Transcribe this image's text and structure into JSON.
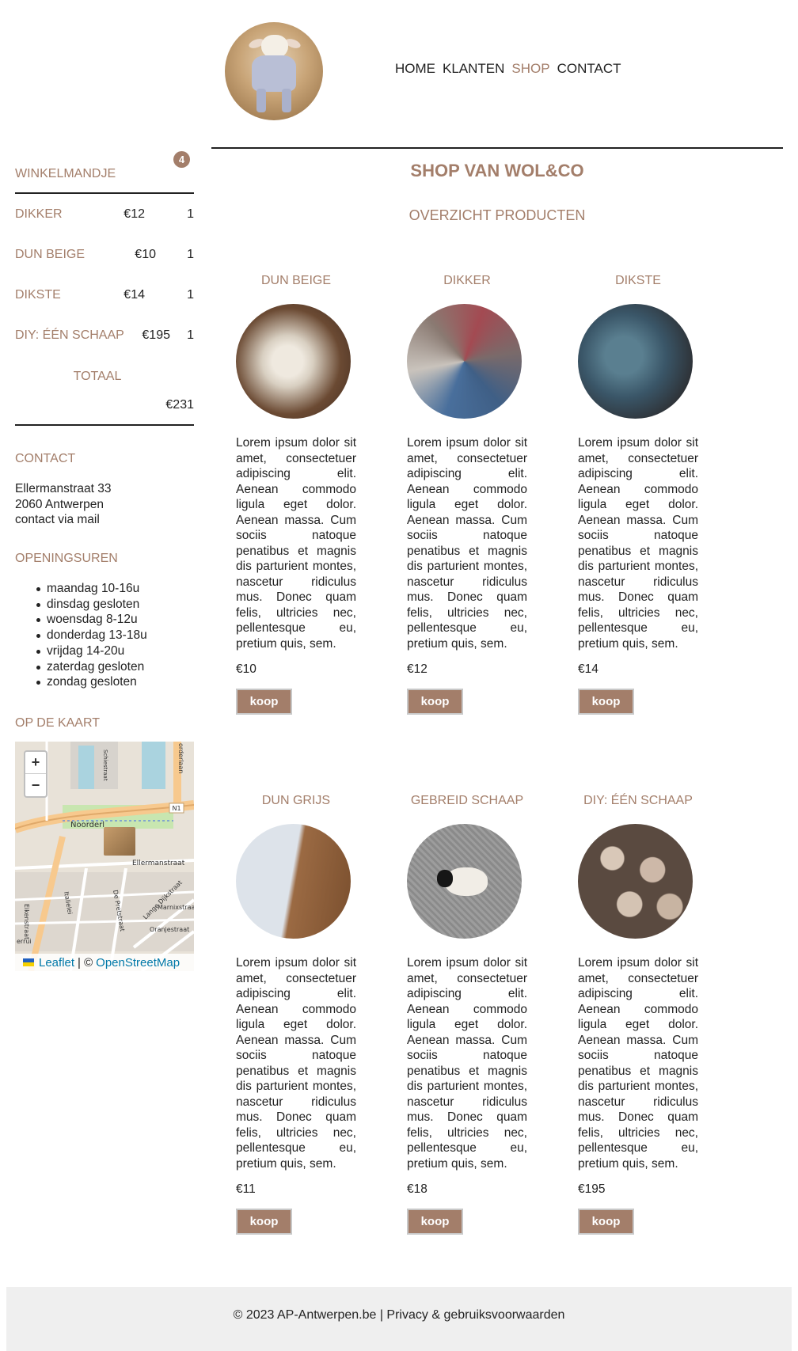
{
  "nav": {
    "items": [
      "HOME",
      "KLANTEN",
      "SHOP",
      "CONTACT"
    ],
    "active": "SHOP",
    "accent": "#a37e6a"
  },
  "logo": {
    "alt_icon": "lamb-logo"
  },
  "cart": {
    "title": "WINKELMANDJE",
    "badge": "4",
    "items": [
      {
        "name": "DIKKER",
        "price": "€12",
        "qty": "1"
      },
      {
        "name": "DUN BEIGE",
        "price": "€10",
        "qty": "1"
      },
      {
        "name": "DIKSTE",
        "price": "€14",
        "qty": "1"
      },
      {
        "name": "DIY: ÉÉN SCHAAP",
        "price": "€195",
        "qty": "1"
      }
    ],
    "total_label": "TOTAAL",
    "total_value": "€231"
  },
  "contact": {
    "title": "CONTACT",
    "street": "Ellermanstraat 33",
    "city": "2060 Antwerpen",
    "mail": "contact via mail"
  },
  "hours": {
    "title": "OPENINGSUREN",
    "items": [
      "maandag 10-16u",
      "dinsdag gesloten",
      "woensdag 8-12u",
      "donderdag 13-18u",
      "vrijdag 14-20u",
      "zaterdag gesloten",
      "zondag gesloten"
    ]
  },
  "map": {
    "title": "OP DE KAART",
    "zoom_in": "+",
    "zoom_out": "−",
    "labels": [
      "Noorderl",
      "Ellermanstraat",
      "N1",
      "Italielei",
      "De Pretstraat",
      "Lange Dijkstraat",
      "Oranjestraat",
      "Marnixstraat",
      "Eikenstraat",
      "errui",
      "Schiestraat",
      "orderlaan"
    ],
    "attribution_leaflet": "Leaflet",
    "attribution_sep": "| ©",
    "attribution_osm": "OpenStreetMap"
  },
  "main": {
    "title": "SHOP VAN WOL&CO",
    "subtitle": "OVERZICHT PRODUCTEN"
  },
  "products": [
    {
      "name": "DUN BEIGE",
      "price": "€10",
      "button": "koop",
      "desc": "Lorem ipsum dolor sit amet, consectetuer adipiscing elit. Aenean commodo ligula eget dolor. Aenean massa. Cum sociis natoque penatibus et magnis dis parturient montes, nascetur ridiculus mus. Donec quam felis, ultricies nec, pellentesque eu, pretium quis, sem."
    },
    {
      "name": "DIKKER",
      "price": "€12",
      "button": "koop",
      "desc": "Lorem ipsum dolor sit amet, consectetuer adipiscing elit. Aenean commodo ligula eget dolor. Aenean massa. Cum sociis natoque penatibus et magnis dis parturient montes, nascetur ridiculus mus. Donec quam felis, ultricies nec, pellentesque eu, pretium quis, sem."
    },
    {
      "name": "DIKSTE",
      "price": "€14",
      "button": "koop",
      "desc": "Lorem ipsum dolor sit amet, consectetuer adipiscing elit. Aenean commodo ligula eget dolor. Aenean massa. Cum sociis natoque penatibus et magnis dis parturient montes, nascetur ridiculus mus. Donec quam felis, ultricies nec, pellentesque eu, pretium quis, sem."
    },
    {
      "name": "DUN GRIJS",
      "price": "€11",
      "button": "koop",
      "desc": "Lorem ipsum dolor sit amet, consectetuer adipiscing elit. Aenean commodo ligula eget dolor. Aenean massa. Cum sociis natoque penatibus et magnis dis parturient montes, nascetur ridiculus mus. Donec quam felis, ultricies nec, pellentesque eu, pretium quis, sem."
    },
    {
      "name": "GEBREID SCHAAP",
      "price": "€18",
      "button": "koop",
      "desc": "Lorem ipsum dolor sit amet, consectetuer adipiscing elit. Aenean commodo ligula eget dolor. Aenean massa. Cum sociis natoque penatibus et magnis dis parturient montes, nascetur ridiculus mus. Donec quam felis, ultricies nec, pellentesque eu, pretium quis, sem."
    },
    {
      "name": "DIY: ÉÉN SCHAAP",
      "price": "€195",
      "button": "koop",
      "desc": "Lorem ipsum dolor sit amet, consectetuer adipiscing elit. Aenean commodo ligula eget dolor. Aenean massa. Cum sociis natoque penatibus et magnis dis parturient montes, nascetur ridiculus mus. Donec quam felis, ultricies nec, pellentesque eu, pretium quis, sem."
    }
  ],
  "footer": {
    "text": "© 2023 AP-Antwerpen.be | Privacy & gebruiksvoorwaarden"
  }
}
